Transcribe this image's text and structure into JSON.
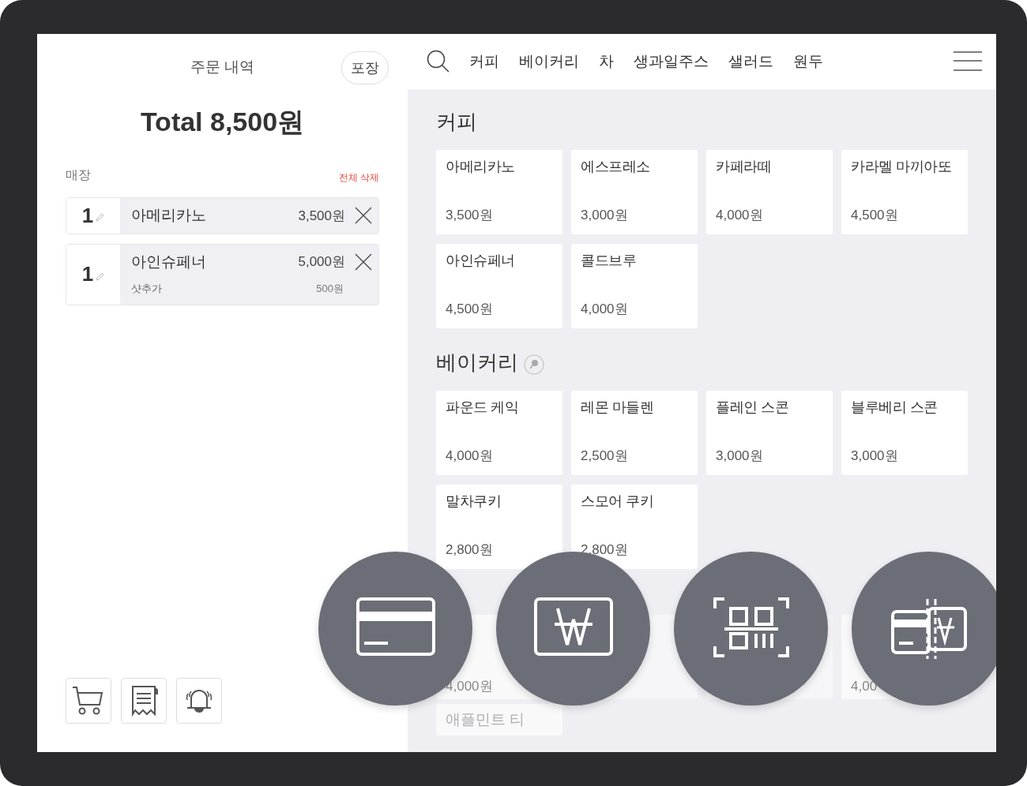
{
  "order_panel": {
    "title": "주문 내역",
    "takeout_button": "포장",
    "total": "Total 8,500원",
    "location": "매장",
    "clear_all": "전체 삭제",
    "items": [
      {
        "qty": "1",
        "name": "아메리카노",
        "price": "3,500원"
      },
      {
        "qty": "1",
        "name": "아인슈페너",
        "price": "5,000원",
        "options": [
          {
            "name": "샷추가",
            "price": "500원"
          }
        ]
      }
    ]
  },
  "nav": {
    "categories": [
      {
        "label": "커피"
      },
      {
        "label": "베이커리"
      },
      {
        "label": "차"
      },
      {
        "label": "생과일주스"
      },
      {
        "label": "샐러드"
      },
      {
        "label": "원두"
      }
    ]
  },
  "sections": [
    {
      "title": "커피",
      "badge": false,
      "faded": false,
      "products": [
        {
          "name": "아메리카노",
          "price": "3,500원"
        },
        {
          "name": "에스프레소",
          "price": "3,000원"
        },
        {
          "name": "카페라떼",
          "price": "4,000원"
        },
        {
          "name": "카라멜 마끼아또",
          "price": "4,500원"
        },
        {
          "name": "아인슈페너",
          "price": "4,500원"
        },
        {
          "name": "콜드브루",
          "price": "4,000원"
        }
      ]
    },
    {
      "title": "베이커리",
      "badge": true,
      "faded": false,
      "products": [
        {
          "name": "파운드 케익",
          "price": "4,000원"
        },
        {
          "name": "레몬 마들렌",
          "price": "2,500원"
        },
        {
          "name": "플레인 스콘",
          "price": "3,000원"
        },
        {
          "name": "블루베리 스콘",
          "price": "3,000원"
        },
        {
          "name": "말차쿠키",
          "price": "2,800원"
        },
        {
          "name": "스모어 쿠키",
          "price": "2,800원"
        }
      ]
    },
    {
      "faded": true,
      "products": [
        {
          "price": "4,000원"
        },
        {
          "blank": true
        },
        {
          "blank": true
        },
        {
          "price": "4,00"
        },
        {
          "name": "애플민트 티"
        }
      ]
    }
  ],
  "payment_buttons": [
    {
      "kind": "card"
    },
    {
      "kind": "cash"
    },
    {
      "kind": "qr"
    },
    {
      "kind": "split"
    }
  ]
}
